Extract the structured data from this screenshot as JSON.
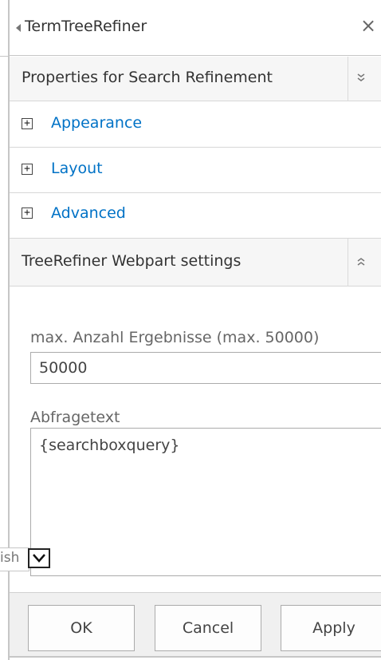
{
  "pane": {
    "title": "TermTreeRefiner",
    "close_glyph": "×"
  },
  "sections": {
    "properties": {
      "title": "Properties for Search Refinement",
      "chevron": "collapse-chevron-icon"
    },
    "webpart": {
      "title": "TreeRefiner Webpart settings",
      "chevron": "expand-chevron-icon"
    }
  },
  "categories": [
    {
      "label": "Appearance",
      "toggle": "+"
    },
    {
      "label": "Layout",
      "toggle": "+"
    },
    {
      "label": "Advanced",
      "toggle": "+"
    }
  ],
  "fields": {
    "max_results": {
      "label": "max. Anzahl Ergebnisse (max. 50000)",
      "value": "50000"
    },
    "query_text": {
      "label": "Abfragetext",
      "value": "{searchboxquery}"
    }
  },
  "language_dropdown": {
    "visible_text": "ish"
  },
  "buttons": {
    "ok": "OK",
    "cancel": "Cancel",
    "apply": "Apply"
  },
  "colors": {
    "link": "#0072c6",
    "section_bg": "#f6f6f6",
    "border": "#c6c6c6"
  }
}
